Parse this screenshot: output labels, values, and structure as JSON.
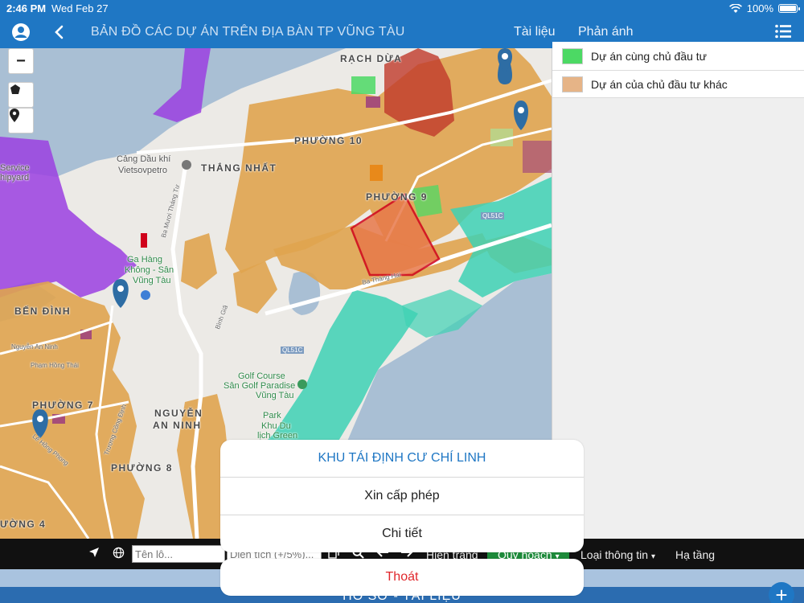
{
  "status_bar": {
    "time": "2:46 PM",
    "date": "Wed Feb 27",
    "battery": "100%"
  },
  "header": {
    "title": "BẢN ĐỒ CÁC DỰ ÁN TRÊN ĐỊA BÀN TP VŨNG TÀU",
    "links": [
      "Tài liệu",
      "Phản ánh"
    ]
  },
  "map": {
    "zoom_out_label": "−",
    "labels": {
      "rach_dua": "RẠCH DỪA",
      "phuong_10": "PHƯỜNG 10",
      "thang_nhat": "THẮNG NHẤT",
      "phuong_9_mid": "PHƯỜNG 9",
      "cang_dau_khi": "Cảng Dầu khí",
      "vietsovpetro": "Vietsovpetro",
      "service": "Service",
      "shipyard": "hipyard",
      "ga_hang": "Ga Hàng",
      "chung_san": "Không - Sân",
      "vung_tau": "Vũng Tàu",
      "ben_dinh": "BẾN ĐÌNH",
      "nguyen_an_ninh_road": "Nguyễn An Ninh",
      "pham_hong_thai": "Phạm Hồng Thái",
      "phuong_7": "PHƯỜNG 7",
      "nguyen": "NGUYỄN",
      "an_ninh": "AN NINH",
      "golf_course": "Golf Course",
      "san_golf": "Sân Golf Paradise",
      "vung_tau_golf": "Vũng Tàu",
      "park": "Park",
      "khu_du": "Khu Du",
      "lich_green": "lịch Green",
      "phuong_8": "PHƯỜNG 8",
      "phuong_4": "ƯỜNG 4",
      "ba_thang_hai": "Ba Tháng Hai",
      "ba_muoi_thang_tu": "Ba Mươi Tháng Tư",
      "binh_gia": "Bình Giã",
      "le_hong_phong": "Lê Hồng Phong",
      "truong_cong_dinh": "Trương Công Định",
      "ql51c": "QL51C",
      "ql51c_2": "QL51C"
    }
  },
  "legend": {
    "items": [
      {
        "label": "Dự án cùng chủ đầu tư",
        "color": "#4cd964"
      },
      {
        "label": "Dự án của chủ đầu tư khác",
        "color": "#e6b487"
      }
    ]
  },
  "toolbar": {
    "search_placeholder": "Tên lô...",
    "area_placeholder": "Diện tích (+/5%)...",
    "hien_trang": "Hiện trạng",
    "quy_hoach": "Quy hoạch",
    "loai_thong_tin": "Loại thông tin",
    "ha_tang": "Hạ tầng"
  },
  "footer": {
    "title": "HỒ SƠ - TÀI LIỆU"
  },
  "action_sheet": {
    "title": "KHU TÁI ĐỊNH CƯ CHÍ LINH",
    "options": [
      "Xin cấp phép",
      "Chi tiết"
    ],
    "cancel": "Thoát"
  },
  "colors": {
    "nav_blue": "#1f77c4",
    "planning_orange": "#e0a44f",
    "selected_red": "#d0021b",
    "teal": "#3ed1b4",
    "purple": "#9b3fe0",
    "cancel_red": "#e0262b"
  }
}
